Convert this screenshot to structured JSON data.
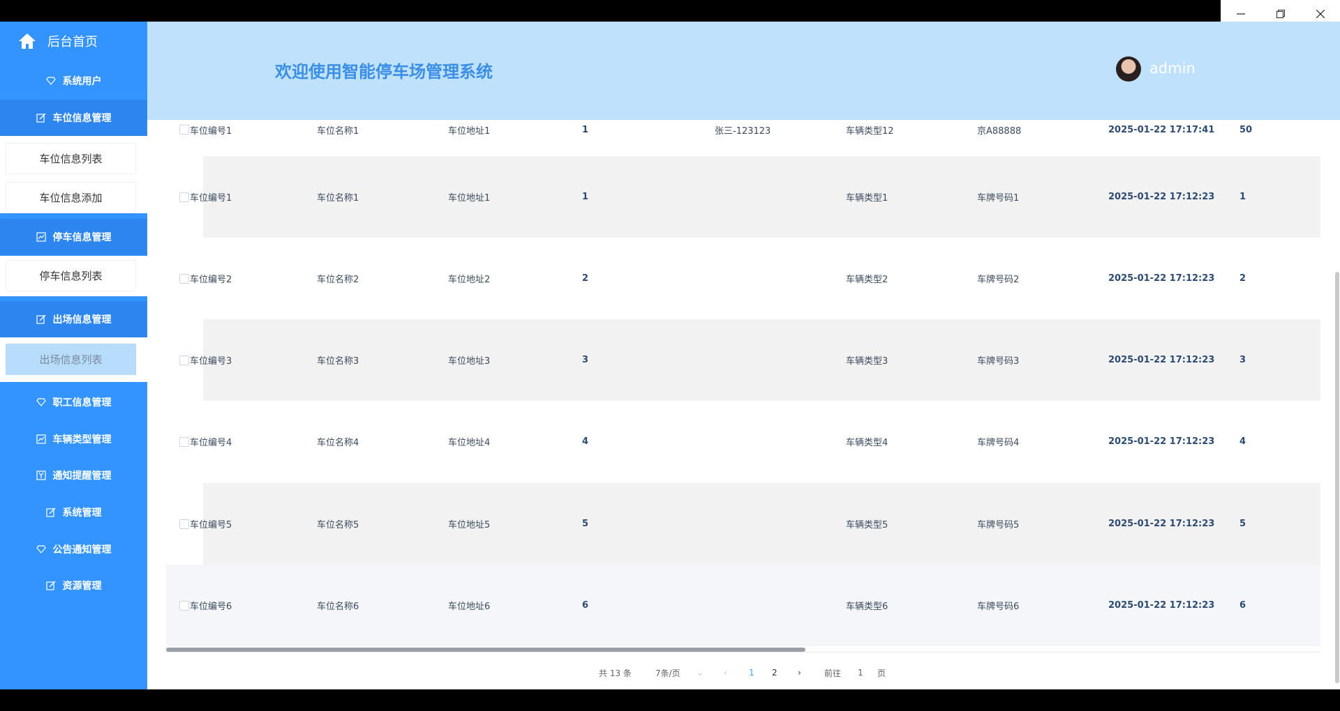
{
  "window": {
    "min_icon": "minimize-icon",
    "max_icon": "restore-icon",
    "close_icon": "close-icon"
  },
  "sidebar": {
    "home_label": "后台首页",
    "menu": [
      {
        "label": "系统用户",
        "icon": "diamond-icon"
      },
      {
        "label": "车位信息管理",
        "icon": "edit-icon"
      },
      {
        "label": "停车信息管理",
        "icon": "chart-icon"
      },
      {
        "label": "出场信息管理",
        "icon": "edit-icon"
      },
      {
        "label": "职工信息管理",
        "icon": "diamond-icon"
      },
      {
        "label": "车辆类型管理",
        "icon": "chart-icon"
      },
      {
        "label": "通知提醒管理",
        "icon": "yen-icon"
      },
      {
        "label": "系统管理",
        "icon": "edit-icon"
      },
      {
        "label": "公告通知管理",
        "icon": "diamond-icon"
      },
      {
        "label": "资源管理",
        "icon": "edit-icon"
      }
    ],
    "submenu": {
      "parking_space": [
        "车位信息列表",
        "车位信息添加"
      ],
      "parking": [
        "停车信息列表"
      ],
      "exit": [
        "出场信息列表"
      ]
    }
  },
  "header": {
    "title": "欢迎使用智能停车场管理系统",
    "username": "admin"
  },
  "table": {
    "rows": [
      [
        "车位编号1",
        "车位名称1",
        "车位地址1",
        "1",
        "张三-123123",
        "车辆类型12",
        "京A88888",
        "2025-01-22 17:17:41",
        "50"
      ],
      [
        "车位编号1",
        "车位名称1",
        "车位地址1",
        "1",
        "",
        "车辆类型1",
        "车牌号码1",
        "2025-01-22 17:12:23",
        "1"
      ],
      [
        "车位编号2",
        "车位名称2",
        "车位地址2",
        "2",
        "",
        "车辆类型2",
        "车牌号码2",
        "2025-01-22 17:12:23",
        "2"
      ],
      [
        "车位编号3",
        "车位名称3",
        "车位地址3",
        "3",
        "",
        "车辆类型3",
        "车牌号码3",
        "2025-01-22 17:12:23",
        "3"
      ],
      [
        "车位编号4",
        "车位名称4",
        "车位地址4",
        "4",
        "",
        "车辆类型4",
        "车牌号码4",
        "2025-01-22 17:12:23",
        "4"
      ],
      [
        "车位编号5",
        "车位名称5",
        "车位地址5",
        "5",
        "",
        "车辆类型5",
        "车牌号码5",
        "2025-01-22 17:12:23",
        "5"
      ],
      [
        "车位编号6",
        "车位名称6",
        "车位地址6",
        "6",
        "",
        "车辆类型6",
        "车牌号码6",
        "2025-01-22 17:12:23",
        "6"
      ]
    ]
  },
  "pagination": {
    "total": "共 13 条",
    "page_size": "7条/页",
    "pages": [
      "1",
      "2"
    ],
    "current": "1",
    "goto_prefix": "前往",
    "goto_value": "1",
    "goto_suffix": "页"
  }
}
